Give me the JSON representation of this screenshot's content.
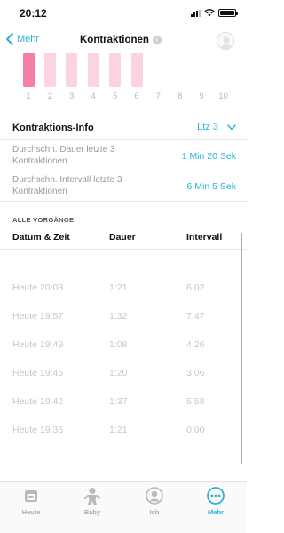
{
  "status": {
    "time": "20:12"
  },
  "nav": {
    "back_label": "Mehr",
    "title": "Kontraktionen"
  },
  "chart_data": {
    "type": "bar",
    "categories": [
      "1",
      "2",
      "3",
      "4",
      "5",
      "6",
      "7",
      "8",
      "9",
      "10"
    ],
    "series": [
      {
        "values": [
          1,
          1,
          1,
          1,
          1,
          1,
          0,
          0,
          0,
          0
        ]
      }
    ],
    "colors": {
      "first_bar": "#f57fa8",
      "other_bars": "#fbd3e1",
      "tick_label": "#b8b8b8"
    }
  },
  "info": {
    "title": "Kontraktions-Info",
    "range_label": "Ltz 3",
    "stats": [
      {
        "label": "Durchschn. Dauer letzte 3 Kontraktionen",
        "value": "1 Min 20 Sek"
      },
      {
        "label": "Durchschn. Intervall letzte 3 Kontraktionen",
        "value": "6 Min 5 Sek"
      }
    ]
  },
  "history": {
    "section_label": "ALLE VORGÄNGE",
    "columns": [
      "Datum & Zeit",
      "Dauer",
      "Intervall"
    ],
    "rows": [
      {
        "datetime": "Heute 20:03",
        "duration": "1:21",
        "interval": "6:02"
      },
      {
        "datetime": "Heute 19:57",
        "duration": "1:32",
        "interval": "7:47"
      },
      {
        "datetime": "Heute 19:49",
        "duration": "1:08",
        "interval": "4:26"
      },
      {
        "datetime": "Heute 19:45",
        "duration": "1:20",
        "interval": "3:06"
      },
      {
        "datetime": "Heute 19:42",
        "duration": "1:37",
        "interval": "5:58"
      },
      {
        "datetime": "Heute 19:36",
        "duration": "1:21",
        "interval": "0:00"
      }
    ]
  },
  "tabs": [
    {
      "label": "Heute",
      "icon": "calendar-icon",
      "active": false
    },
    {
      "label": "Baby",
      "icon": "baby-icon",
      "active": false
    },
    {
      "label": "Ich",
      "icon": "person-icon",
      "active": false
    },
    {
      "label": "Mehr",
      "icon": "more-icon",
      "active": true
    }
  ],
  "colors": {
    "accent": "#2bb3d6"
  }
}
